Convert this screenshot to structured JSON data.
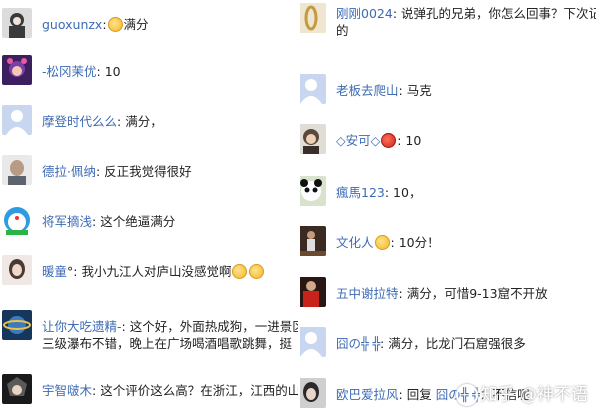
{
  "left_column": [
    {
      "name": "guoxunzx",
      "sep": ":",
      "emoji_before": true,
      "text": "满分",
      "avatar_icon": "woman-portrait-icon",
      "avatar_color": "#3a3a3a"
    },
    {
      "name": "-松冈茉优",
      "sep": ": ",
      "text": "10",
      "avatar_icon": "anime-girl-avatar-icon",
      "avatar_color": "#7b3fa6"
    },
    {
      "name": "摩登时代么么",
      "sep": ": ",
      "text": "满分，",
      "avatar_icon": "default-user-avatar-icon",
      "avatar_color": "#c8d7ef"
    },
    {
      "name": "德拉·佩纳",
      "sep": ": ",
      "text": "反正我觉得很好",
      "avatar_icon": "bald-man-portrait-icon",
      "avatar_color": "#b99a82"
    },
    {
      "name": "将军摘浅",
      "sep": ": ",
      "text": "这个绝逼满分",
      "avatar_icon": "doraemon-avatar-icon",
      "avatar_color": "#2f9be0"
    },
    {
      "name": "暖童",
      "sep": "°: ",
      "text": "我小九江人对庐山没感觉啊",
      "emoji_after_count": 2,
      "avatar_icon": "girl-portrait-icon",
      "avatar_color": "#d9c7bd"
    },
    {
      "name": "让你大吃遗精-",
      "sep": ": ",
      "text": "这个好，外面热成狗，一进景区",
      "text2": "三级瀑布不错，晚上在广场喝酒唱歌跳舞，挺",
      "avatar_icon": "planet-badge-avatar-icon",
      "avatar_color": "#16365c"
    },
    {
      "name": "宇智啵木",
      "sep": ": ",
      "text": "这个评价这么高？在浙江，江西的山",
      "avatar_icon": "anime-character-avatar-icon",
      "avatar_color": "#1a1a1a"
    }
  ],
  "right_column": [
    {
      "name": "刚刚0024",
      "sep": ": ",
      "text": "说弹孔的兄弟，你怎么回事？下次记",
      "text2": "的",
      "avatar_icon": "gold-ring-avatar-icon",
      "avatar_color": "#efe6d2"
    },
    {
      "name": "老板去爬山",
      "sep": ": ",
      "text": "马克",
      "avatar_icon": "default-user-avatar-icon",
      "avatar_color": "#c8d7ef"
    },
    {
      "name": "◇安可◇",
      "sep": ": ",
      "emoji_red": true,
      "text": "10",
      "avatar_icon": "cartoon-face-avatar-icon",
      "avatar_color": "#5b4a3a"
    },
    {
      "name": "瘋馬123",
      "sep": ": ",
      "text": "10，",
      "avatar_icon": "panda-avatar-icon",
      "avatar_color": "#e8e8e8"
    },
    {
      "name": "文化人",
      "sep": ": ",
      "emoji_before": true,
      "text": "10分！",
      "avatar_icon": "athlete-photo-avatar-icon",
      "avatar_color": "#3b2a22"
    },
    {
      "name": "五中谢拉特",
      "sep": ": ",
      "text": "满分，可惜9-13窟不开放",
      "avatar_icon": "football-player-avatar-icon",
      "avatar_color": "#8a1a12"
    },
    {
      "name": "囧の╬ ╬",
      "sep": ": ",
      "text": "满分，比龙门石窟强很多",
      "avatar_icon": "default-user-avatar-icon",
      "avatar_color": "#c8d7ef"
    },
    {
      "name": "欧巴爱拉风",
      "sep": ": ",
      "text": "回复 ",
      "reply_to": "囧の╬ ╬",
      "text_tail": "：不信呢",
      "avatar_icon": "singer-portrait-avatar-icon",
      "avatar_color": "#2a2a2a"
    }
  ],
  "watermark": {
    "text": "知乎 @神不语"
  }
}
